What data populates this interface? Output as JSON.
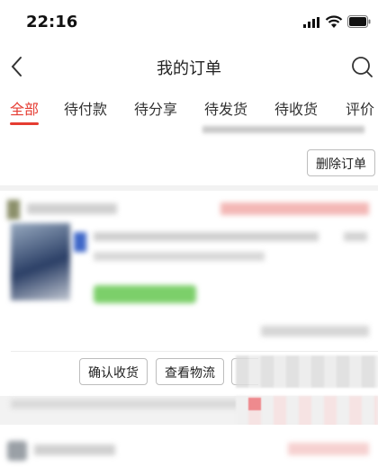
{
  "status_bar": {
    "time": "22:16"
  },
  "nav": {
    "title": "我的订单"
  },
  "tabs": [
    {
      "label": "全部",
      "active": true
    },
    {
      "label": "待付款",
      "active": false
    },
    {
      "label": "待分享",
      "active": false
    },
    {
      "label": "待发货",
      "active": false
    },
    {
      "label": "待收货",
      "active": false
    },
    {
      "label": "评价",
      "active": false
    }
  ],
  "orders": [
    {
      "buttons": {
        "delete": "删除订单"
      }
    },
    {
      "buttons": {
        "confirm_receipt": "确认收货",
        "view_logistics": "查看物流"
      }
    }
  ],
  "colors": {
    "accent": "#e53c32",
    "background": "#f2f2f2",
    "card": "#ffffff"
  },
  "icons": {
    "back": "chevron-left-icon",
    "search": "search-icon",
    "signal": "signal-icon",
    "wifi": "wifi-icon",
    "battery": "battery-icon"
  }
}
